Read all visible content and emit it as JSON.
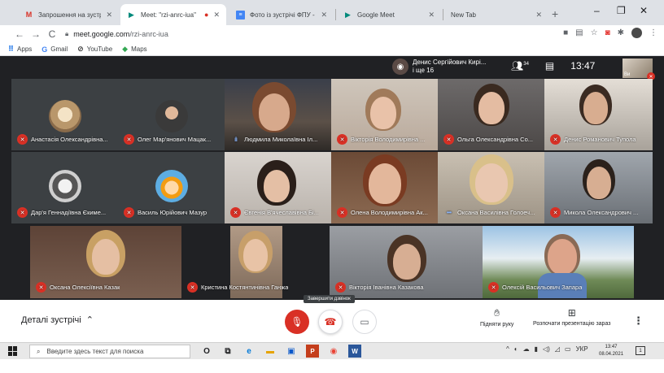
{
  "browser": {
    "tabs": [
      {
        "title": "Запрошення на зустріч \"Зустр",
        "favicon": "gmail-icon",
        "active": false
      },
      {
        "title": "Meet: \"rzi-anrc-iua\"",
        "favicon": "google-meet-icon",
        "active": true
      },
      {
        "title": "Фото із зустрічі ФПУ - Google",
        "favicon": "google-docs-icon",
        "active": false
      },
      {
        "title": "Google Meet",
        "favicon": "google-meet-icon",
        "active": false
      },
      {
        "title": "New Tab",
        "favicon": "",
        "active": false
      }
    ],
    "url_host": "meet.google.com",
    "url_path": "/rzi-anrc-iua",
    "bookmarks": [
      {
        "label": "Apps",
        "icon": "apps-grid-icon"
      },
      {
        "label": "Gmail",
        "icon": "google-icon"
      },
      {
        "label": "YouTube",
        "icon": "youtube-icon"
      },
      {
        "label": "Maps",
        "icon": "maps-icon"
      }
    ]
  },
  "meet": {
    "presenter_name": "Денис Сергійович Кирі...",
    "presenter_extra": "і ще 16",
    "participant_count": "34",
    "time": "13:47",
    "self_label": "Ви",
    "tiles": [
      {
        "name": "Анастасія Олександрівна...",
        "muted": true
      },
      {
        "name": "Олег Мар'янович Мацак...",
        "muted": true
      },
      {
        "name": "Людмила Миколаївна Іл...",
        "muted": false
      },
      {
        "name": "Вікторія Володимирівна ...",
        "muted": true
      },
      {
        "name": "Ольга Олександрівна Со...",
        "muted": true
      },
      {
        "name": "Денис Романович Тупола",
        "muted": true
      },
      {
        "name": "Дар'я Геннадіївна Єкиме...",
        "muted": true
      },
      {
        "name": "Василь Юрійович Мазур",
        "muted": true
      },
      {
        "name": "Євгенія В'ячеславівна Бі...",
        "muted": true
      },
      {
        "name": "Олена Володимирівна Ак...",
        "muted": true
      },
      {
        "name": "Оксана Василівна Голоеч...",
        "muted": false
      },
      {
        "name": "Микола Олександрович ...",
        "muted": true
      },
      {
        "name": "Оксана Олексіївна Казак",
        "muted": true
      },
      {
        "name": "Кристина Костянтинівна Ганжа",
        "muted": true
      },
      {
        "name": "Вікторія Іванівна Казакова",
        "muted": true
      },
      {
        "name": "Олексій Васильович Запара",
        "muted": true
      }
    ]
  },
  "controls": {
    "details_label": "Деталі зустрічі",
    "hangup_tooltip": "Завершити дзвінок",
    "raise_hand_label": "Підняти руку",
    "present_label": "Розпочати презентацію зараз"
  },
  "taskbar": {
    "search_placeholder": "Введите здесь текст для поиска",
    "lang": "УКР",
    "time": "13:47",
    "date": "08.04.2021",
    "notifications": "1"
  }
}
